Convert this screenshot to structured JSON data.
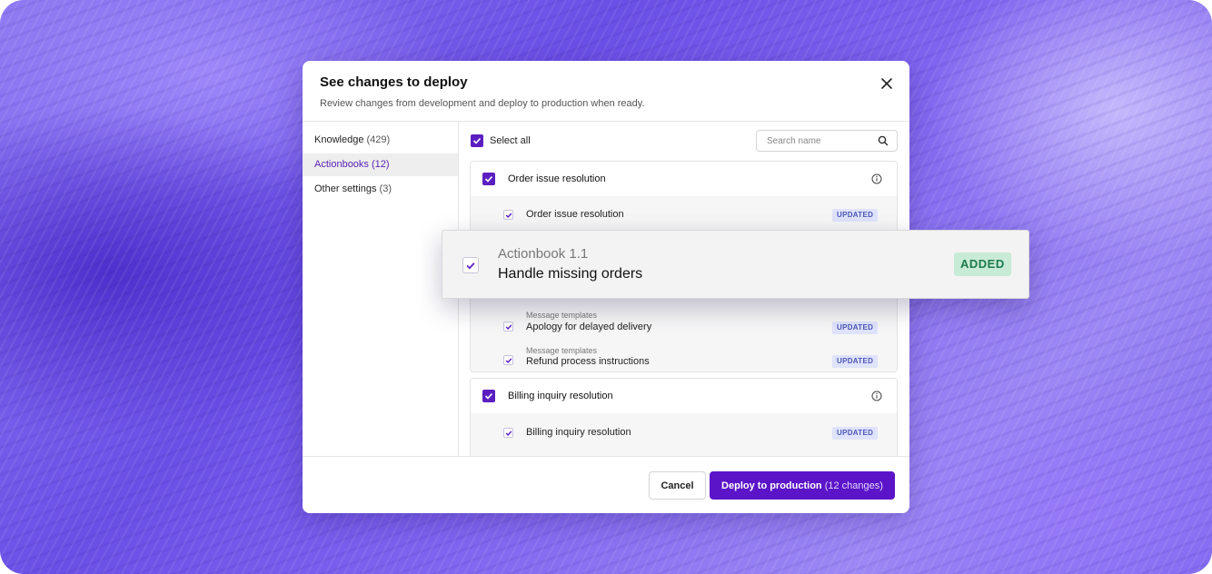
{
  "modal": {
    "title": "See changes to deploy",
    "subtitle": "Review changes from development and deploy to production when ready.",
    "close_icon": "close-icon"
  },
  "sidebar": {
    "items": [
      {
        "label": "Knowledge",
        "count": "(429)",
        "active": false
      },
      {
        "label": "Actionbooks",
        "count": "(12)",
        "active": true
      },
      {
        "label": "Other settings",
        "count": "(3)",
        "active": false
      }
    ]
  },
  "main": {
    "select_all_label": "Select all",
    "select_all_checked": true,
    "search_placeholder": "Search name",
    "groups": [
      {
        "title": "Order issue resolution",
        "checked": true,
        "rows": [
          {
            "category": "",
            "label": "Order issue resolution",
            "badge": "UPDATED",
            "checked": true
          },
          {
            "category": "Message templates",
            "label": "Apology for delayed delivery",
            "badge": "UPDATED",
            "checked": true
          },
          {
            "category": "Message templates",
            "label": "Refund process instructions",
            "badge": "UPDATED",
            "checked": true
          }
        ]
      },
      {
        "title": "Billing inquiry resolution",
        "checked": true,
        "rows": [
          {
            "category": "",
            "label": "Billing inquiry resolution",
            "badge": "UPDATED",
            "checked": true
          }
        ]
      }
    ]
  },
  "popout": {
    "category": "Actionbook 1.1",
    "title": "Handle missing orders",
    "badge": "ADDED",
    "checked": true
  },
  "footer": {
    "cancel_label": "Cancel",
    "deploy_label": "Deploy to production",
    "deploy_count": "(12 changes)"
  },
  "colors": {
    "accent": "#5b14c8",
    "updated_badge_bg": "#dfe3fb",
    "added_badge_bg": "#c8ebd6"
  }
}
